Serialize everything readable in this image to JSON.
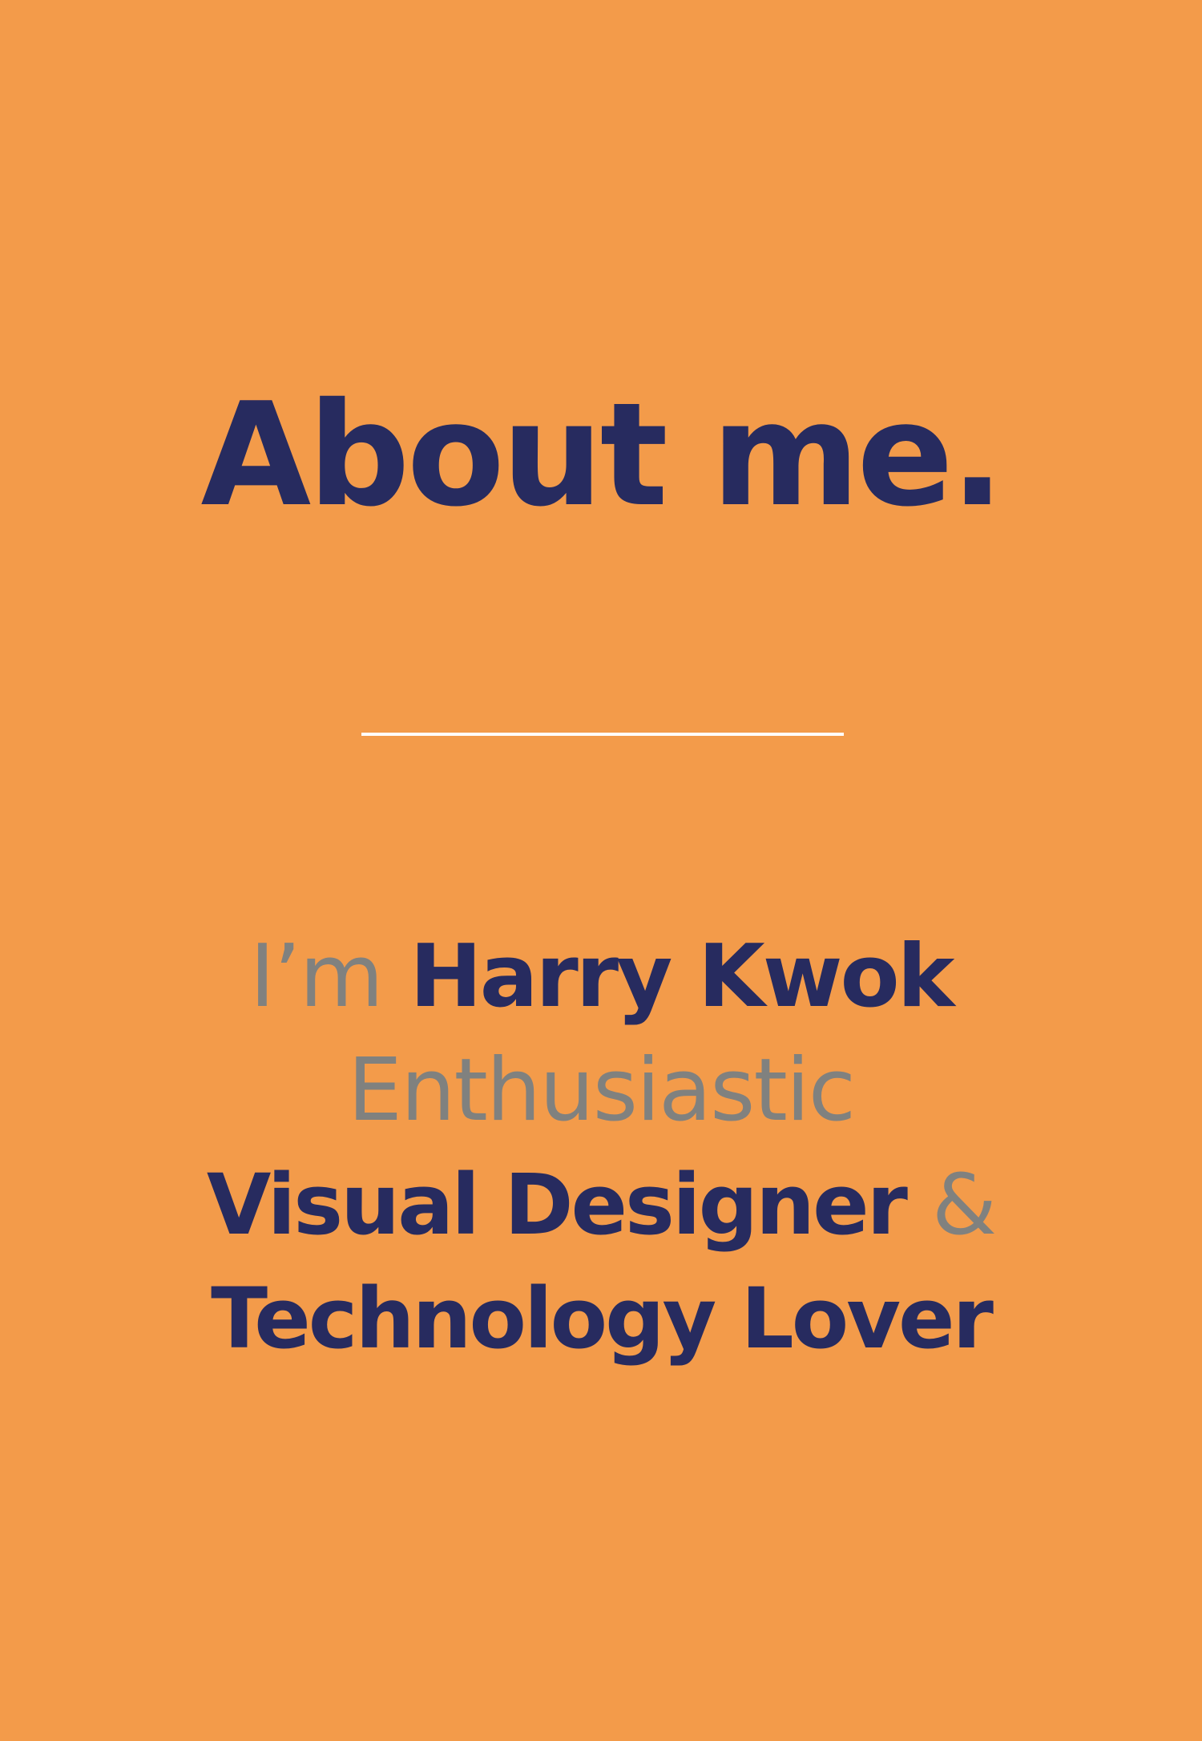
{
  "heading": {
    "title": "About me."
  },
  "intro": {
    "line1": {
      "prefix": "I’m",
      "name": "Harry Kwok"
    },
    "line2": {
      "adjective": "Enthusiastic"
    },
    "line3": {
      "role": "Visual Designer",
      "ampersand": "&"
    },
    "line4": {
      "role": "Technology Lover"
    }
  },
  "colors": {
    "background": "#F39B4A",
    "primary": "#272B5F",
    "secondary": "#80817F",
    "divider": "#FFFFFF"
  }
}
